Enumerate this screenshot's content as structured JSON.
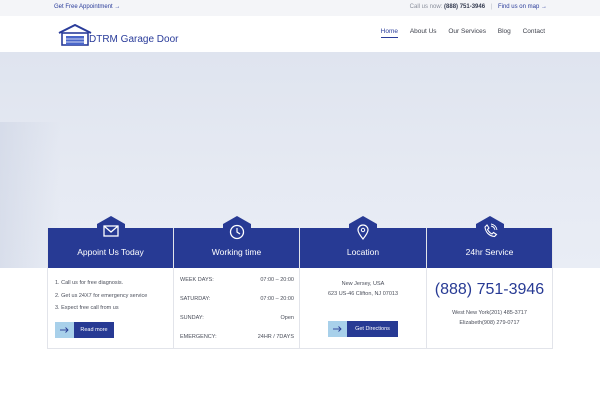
{
  "topbar": {
    "appointment_link": "Get Free Appointment →",
    "call_label": "Call us now:",
    "call_number": "(888) 751-3946",
    "separator": "|",
    "map_link": "Find us on map →"
  },
  "header": {
    "logo_text": "DTRM  Garage Door",
    "nav": [
      "Home",
      "About Us",
      "Our Services",
      "Blog",
      "Contact"
    ],
    "active_nav": "Home"
  },
  "colors": {
    "brand": "#273a94",
    "accent": "#a8d0ea",
    "hero": "#e3e8f1"
  },
  "cards": [
    {
      "title": "Appoint Us Today",
      "icon": "envelope-icon",
      "steps": [
        "1.   Call us for free diagnosis.",
        "2.   Get us 24X7 for emergency service",
        "3.   Expect free call from us"
      ],
      "button": "Read more"
    },
    {
      "title": "Working time",
      "icon": "clock-icon",
      "hours": [
        {
          "day": "WEEK DAYS:",
          "time": "07:00 – 20:00"
        },
        {
          "day": "SATURDAY:",
          "time": "07:00 – 20:00"
        },
        {
          "day": "SUNDAY:",
          "time": "Open"
        },
        {
          "day": "EMERGENCY:",
          "time": "24HR / 7DAYS"
        }
      ]
    },
    {
      "title": "Location",
      "icon": "map-pin-icon",
      "line1": "New Jersey, USA",
      "line2": "623 US-46 Clifton, NJ 07013",
      "button": "Get Directions"
    },
    {
      "title": "24hr Service",
      "icon": "phone-icon",
      "big_phone": "(888) 751-3946",
      "line1": "West New York(201) 485-3717",
      "line2": "Elizabeth(908) 279-0717"
    }
  ]
}
